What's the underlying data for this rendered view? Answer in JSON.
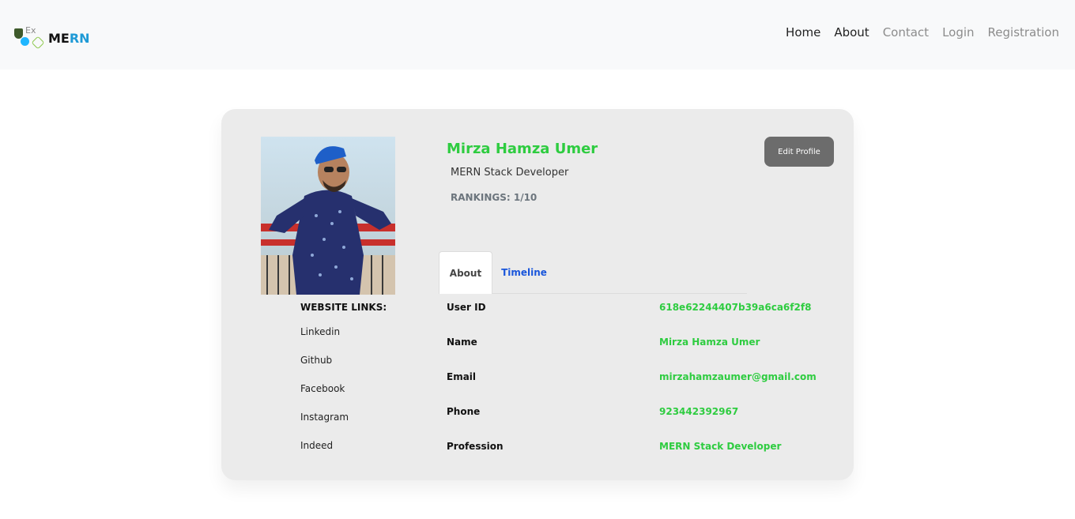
{
  "navbar": {
    "brand": {
      "part1": "ME",
      "part2": "RN",
      "logo_icon": "mern-stack-logo"
    },
    "links": [
      "Home",
      "About",
      "Contact",
      "Login",
      "Registration"
    ]
  },
  "profile": {
    "name": "Mirza Hamza Umer",
    "profession": "MERN Stack Developer",
    "rankings": "RANKINGS: 1/10",
    "edit_label": "Edit Profile"
  },
  "website_links": {
    "heading": "WEBSITE LINKS:",
    "items": [
      "Linkedin",
      "Github",
      "Facebook",
      "Instagram",
      "Indeed"
    ]
  },
  "tabs": {
    "about": "About",
    "timeline": "Timeline"
  },
  "details": [
    {
      "label": "User ID",
      "value": "618e62244407b39a6ca6f2f8"
    },
    {
      "label": "Name",
      "value": "Mirza Hamza Umer"
    },
    {
      "label": "Email",
      "value": "mirzahamzaumer@gmail.com"
    },
    {
      "label": "Phone",
      "value": "923442392967"
    },
    {
      "label": "Profession",
      "value": "MERN Stack Developer"
    }
  ],
  "colors": {
    "accent": "#2ecc40",
    "tab_link": "#1a56db",
    "button": "#6c6c6c"
  }
}
